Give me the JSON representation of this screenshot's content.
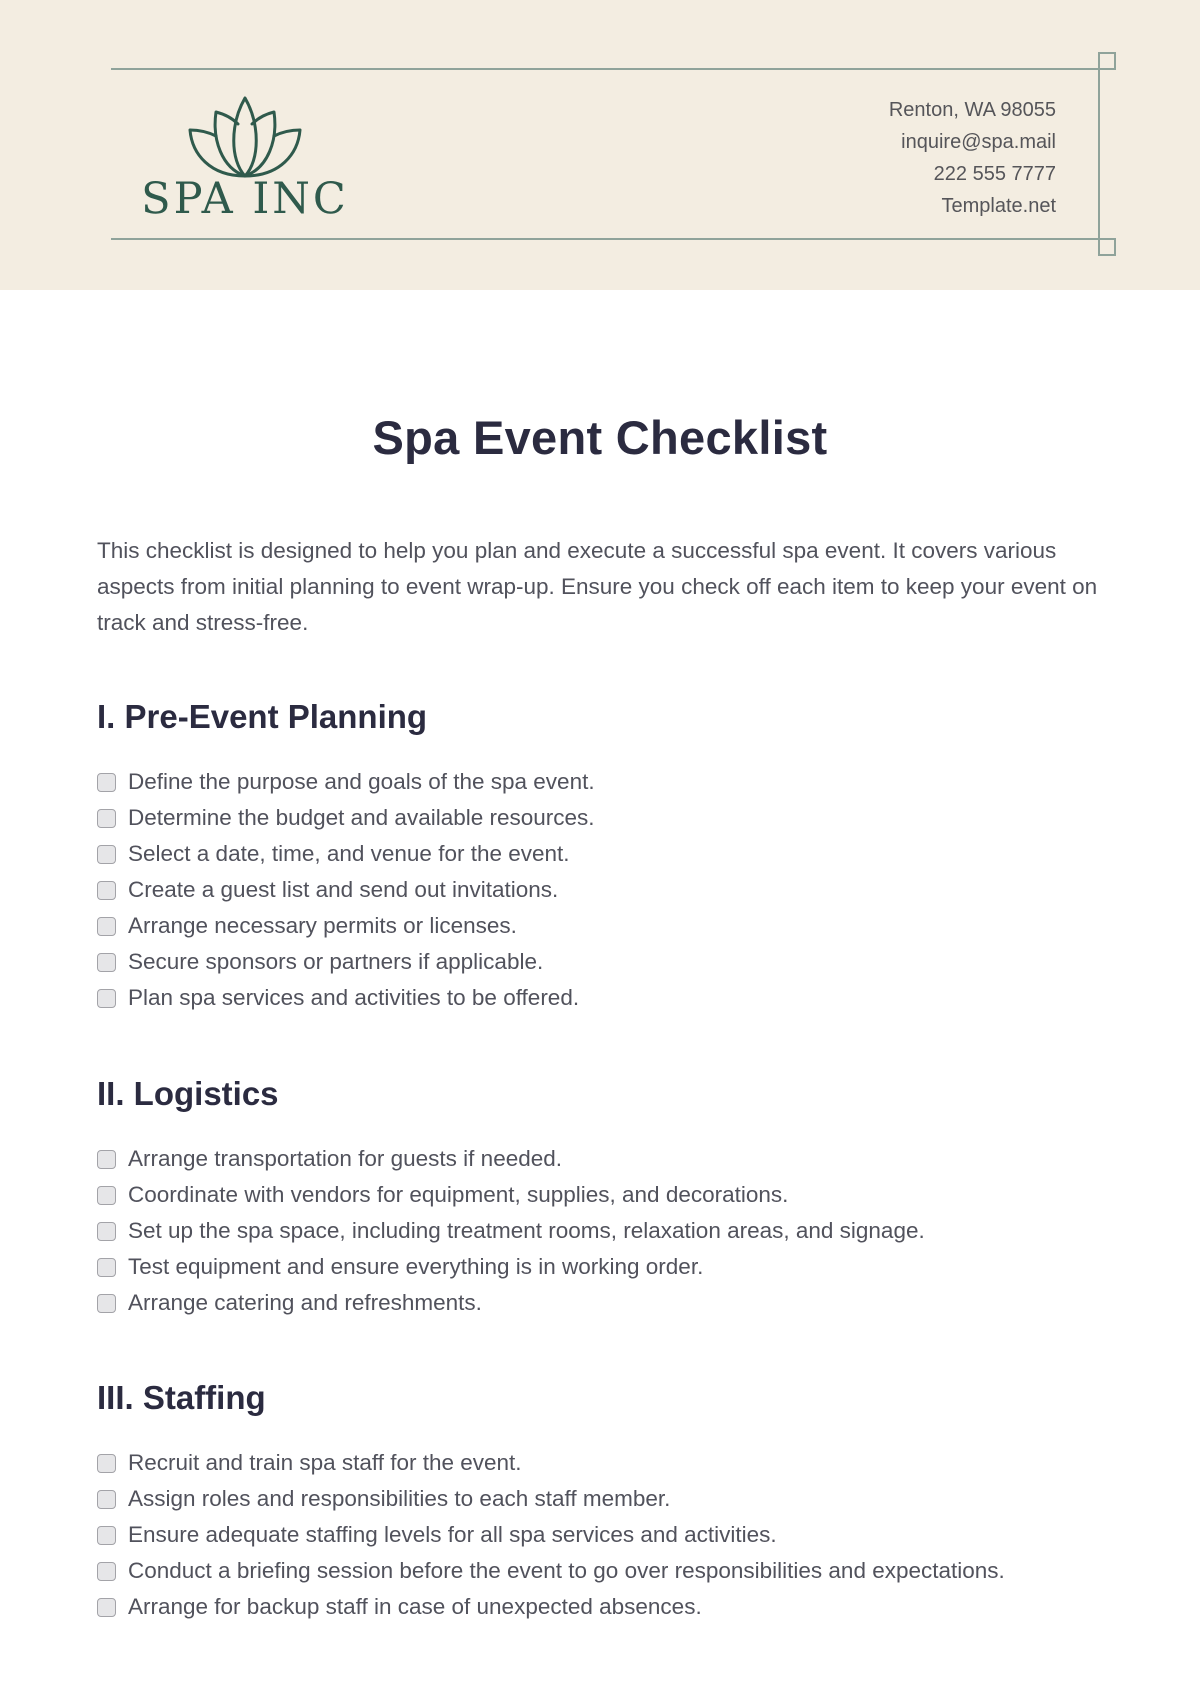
{
  "header": {
    "logo": {
      "icon": "lotus-icon",
      "text": "SPA INC",
      "color": "#2f5a4c"
    },
    "background": "#f3ede1",
    "rule_color": "#8fa39a",
    "contact": {
      "address": "Renton, WA 98055",
      "email": "inquire@spa.mail",
      "phone": "222 555 7777",
      "website": "Template.net"
    }
  },
  "document": {
    "title": "Spa Event Checklist",
    "intro": "This checklist is designed to help you plan and execute a successful spa event. It covers various aspects from initial planning to event wrap-up. Ensure you check off each item to keep your event on track and stress-free.",
    "sections": [
      {
        "heading": "I. Pre-Event Planning",
        "items": [
          {
            "label": "Define the purpose and goals of the spa event.",
            "checked": false
          },
          {
            "label": "Determine the budget and available resources.",
            "checked": false
          },
          {
            "label": "Select a date, time, and venue for the event.",
            "checked": false
          },
          {
            "label": "Create a guest list and send out invitations.",
            "checked": false
          },
          {
            "label": "Arrange necessary permits or licenses.",
            "checked": false
          },
          {
            "label": "Secure sponsors or partners if applicable.",
            "checked": false
          },
          {
            "label": "Plan spa services and activities to be offered.",
            "checked": false
          }
        ]
      },
      {
        "heading": "II. Logistics",
        "items": [
          {
            "label": "Arrange transportation for guests if needed.",
            "checked": false
          },
          {
            "label": "Coordinate with vendors for equipment, supplies, and decorations.",
            "checked": false
          },
          {
            "label": "Set up the spa space, including treatment rooms, relaxation areas, and signage.",
            "checked": false
          },
          {
            "label": "Test equipment and ensure everything is in working order.",
            "checked": false
          },
          {
            "label": "Arrange catering and refreshments.",
            "checked": false
          }
        ]
      },
      {
        "heading": "III. Staffing",
        "items": [
          {
            "label": "Recruit and train spa staff for the event.",
            "checked": false
          },
          {
            "label": "Assign roles and responsibilities to each staff member.",
            "checked": false
          },
          {
            "label": "Ensure adequate staffing levels for all spa services and activities.",
            "checked": false
          },
          {
            "label": "Conduct a briefing session before the event to go over responsibilities and expectations.",
            "checked": false
          },
          {
            "label": "Arrange for backup staff in case of unexpected absences.",
            "checked": false
          }
        ]
      }
    ]
  }
}
